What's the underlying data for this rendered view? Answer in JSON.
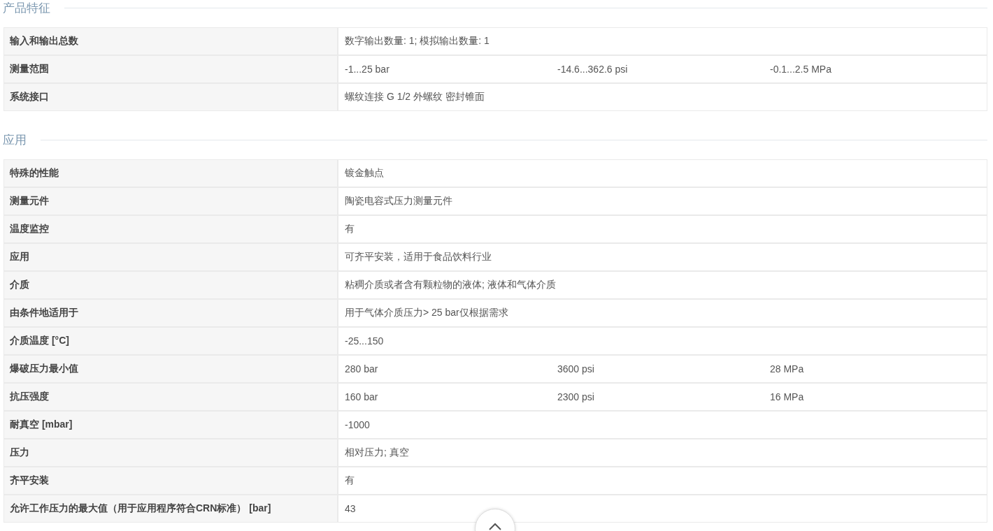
{
  "sections": [
    {
      "title": "产品特征",
      "rows": [
        {
          "label": "输入和输出总数",
          "values": [
            "数字输出数量: 1; 模拟输出数量: 1"
          ]
        },
        {
          "label": "测量范围",
          "values": [
            "-1...25 bar",
            "-14.6...362.6 psi",
            "-0.1...2.5 MPa"
          ]
        },
        {
          "label": "系统接口",
          "values": [
            "螺纹连接 G 1/2 外螺纹 密封锥面"
          ]
        }
      ]
    },
    {
      "title": "应用",
      "rows": [
        {
          "label": "特殊的性能",
          "values": [
            "镀金触点"
          ]
        },
        {
          "label": "测量元件",
          "values": [
            "陶瓷电容式压力测量元件"
          ]
        },
        {
          "label": "温度监控",
          "values": [
            "有"
          ]
        },
        {
          "label": "应用",
          "values": [
            "可齐平安装，适用于食品饮料行业"
          ]
        },
        {
          "label": "介质",
          "values": [
            "粘稠介质或者含有颗粒物的液体; 液体和气体介质"
          ]
        },
        {
          "label": "由条件地适用于",
          "values": [
            "用于气体介质压力> 25 bar仅根据需求"
          ]
        },
        {
          "label": "介质温度 [°C]",
          "values": [
            "-25...150"
          ]
        },
        {
          "label": "爆破压力最小值",
          "values": [
            "280 bar",
            "3600 psi",
            "28 MPa"
          ]
        },
        {
          "label": "抗压强度",
          "values": [
            "160 bar",
            "2300 psi",
            "16 MPa"
          ]
        },
        {
          "label": "耐真空 [mbar]",
          "values": [
            "-1000"
          ]
        },
        {
          "label": "压力",
          "values": [
            "相对压力; 真空"
          ]
        },
        {
          "label": "齐平安装",
          "values": [
            "有"
          ]
        },
        {
          "label": "允许工作压力的最大值（用于应用程序符合CRN标准） [bar]",
          "values": [
            "43"
          ]
        }
      ]
    }
  ]
}
